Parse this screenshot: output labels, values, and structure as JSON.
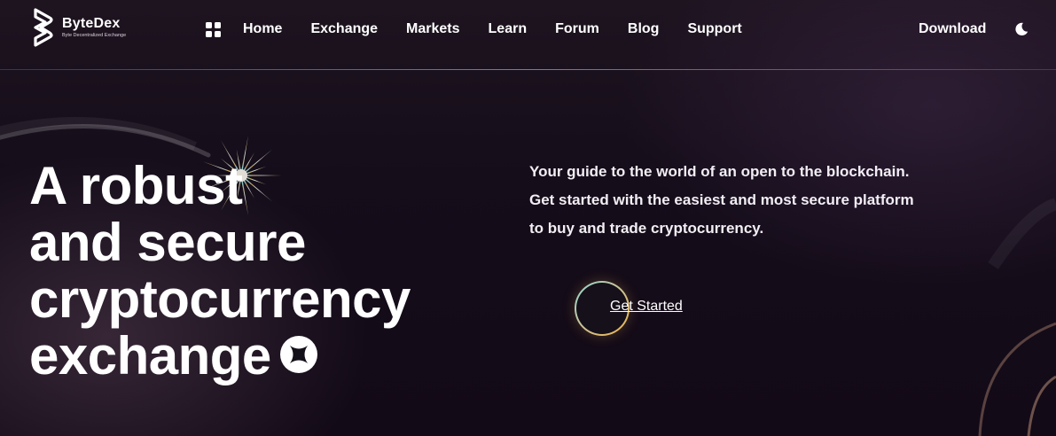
{
  "brand": {
    "name": "ByteDex",
    "tagline": "Byte Decentralized Exchange"
  },
  "nav": {
    "apps_icon": "grid-icon",
    "items": [
      {
        "label": "Home"
      },
      {
        "label": "Exchange"
      },
      {
        "label": "Markets"
      },
      {
        "label": "Learn"
      },
      {
        "label": "Forum"
      },
      {
        "label": "Blog"
      },
      {
        "label": "Support"
      }
    ],
    "download_label": "Download",
    "theme_icon": "moon-icon"
  },
  "hero": {
    "headline_lines": [
      "A robust",
      "and secure",
      "cryptocurrency",
      "exchange"
    ],
    "description_lines": [
      "Your guide to the world of an open to the blockchain.",
      "Get started with the easiest and most secure platform",
      "to buy and trade cryptocurrency."
    ],
    "cta_label": "Get Started"
  },
  "colors": {
    "background": "#120b18",
    "text": "#ffffff",
    "ring_teal": "#8fd6d1",
    "ring_gold": "#f0b24a",
    "star_gold": "#d6b25c",
    "star_teal": "#9fd3cf"
  }
}
